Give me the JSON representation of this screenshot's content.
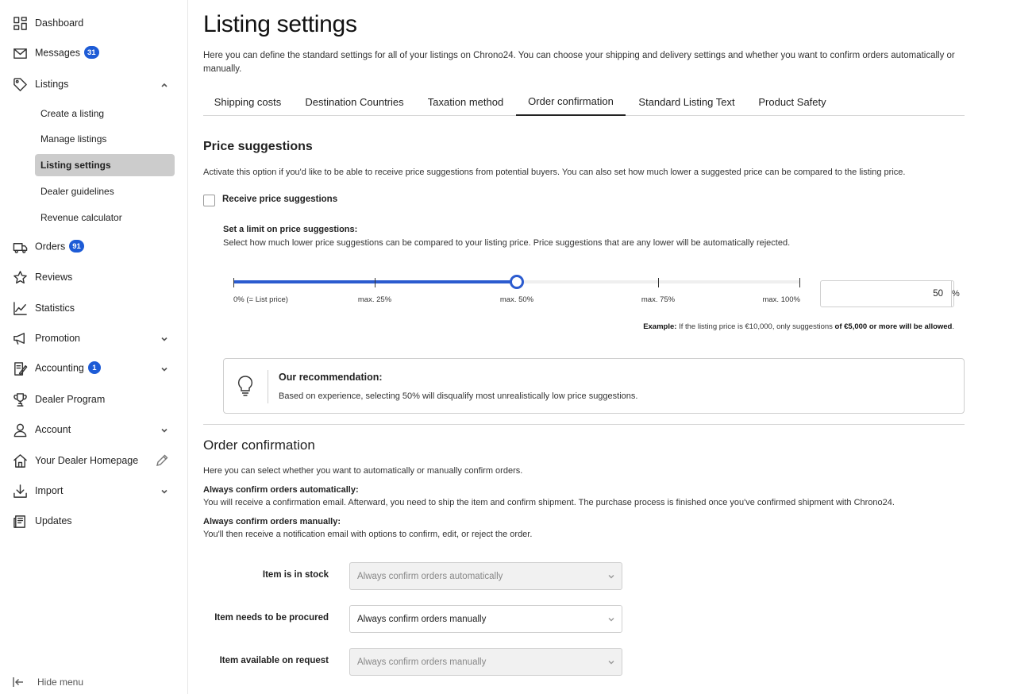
{
  "sidebar": {
    "dashboard": "Dashboard",
    "messages": "Messages",
    "messages_badge": "31",
    "listings": "Listings",
    "listings_sub": [
      "Create a listing",
      "Manage listings",
      "Listing settings",
      "Dealer guidelines",
      "Revenue calculator"
    ],
    "orders": "Orders",
    "orders_badge": "91",
    "reviews": "Reviews",
    "statistics": "Statistics",
    "promotion": "Promotion",
    "accounting": "Accounting",
    "accounting_badge": "1",
    "dealer_program": "Dealer Program",
    "account": "Account",
    "dealer_homepage": "Your Dealer Homepage",
    "import": "Import",
    "updates": "Updates",
    "hide_menu": "Hide menu"
  },
  "page": {
    "title": "Listing settings",
    "intro": "Here you can define the standard settings for all of your listings on Chrono24. You can choose your shipping and delivery settings and whether you want to confirm orders automatically or manually."
  },
  "tabs": [
    "Shipping costs",
    "Destination Countries",
    "Taxation method",
    "Order confirmation",
    "Standard Listing Text",
    "Product Safety"
  ],
  "active_tab": "Order confirmation",
  "price_suggestions": {
    "heading": "Price suggestions",
    "description": "Activate this option if you'd like to be able to receive price suggestions from potential buyers. You can also set how much lower a suggested price can be compared to the listing price.",
    "checkbox_label": "Receive price suggestions",
    "limit_title": "Set a limit on price suggestions:",
    "limit_desc": "Select how much lower price suggestions can be compared to your listing price. Price suggestions that are any lower will be automatically rejected.",
    "slider_labels": [
      "0% (= List price)",
      "max. 25%",
      "max. 50%",
      "max. 75%",
      "max. 100%"
    ],
    "slider_value_percent": 50,
    "input_value": "50",
    "unit": "%",
    "example_label": "Example:",
    "example_text": " If the listing price is €10,000, only suggestions ",
    "example_bold": "of €5,000 or more will be allowed",
    "example_end": ".",
    "reco_title": "Our recommendation:",
    "reco_text": "Based on experience, selecting 50% will disqualify most unrealistically low price suggestions."
  },
  "order_confirmation": {
    "heading": "Order confirmation",
    "description": "Here you can select whether you want to automatically or manually confirm orders.",
    "auto_title": "Always confirm orders automatically:",
    "auto_desc": "You will receive a confirmation email. Afterward, you need to ship the item and confirm shipment. The purchase process is finished once you've confirmed shipment with Chrono24.",
    "manual_title": "Always confirm orders manually:",
    "manual_desc": "You'll then receive a notification email with options to confirm, edit, or reject the order.",
    "rows": [
      {
        "label": "Item is in stock",
        "value": "Always confirm orders automatically"
      },
      {
        "label": "Item needs to be procured",
        "value": "Always confirm orders manually"
      },
      {
        "label": "Item available on request",
        "value": "Always confirm orders manually"
      }
    ]
  },
  "colors": {
    "accent": "#2b5bcf",
    "badge": "#1d5bd6",
    "active_nav": "#cccccc"
  }
}
